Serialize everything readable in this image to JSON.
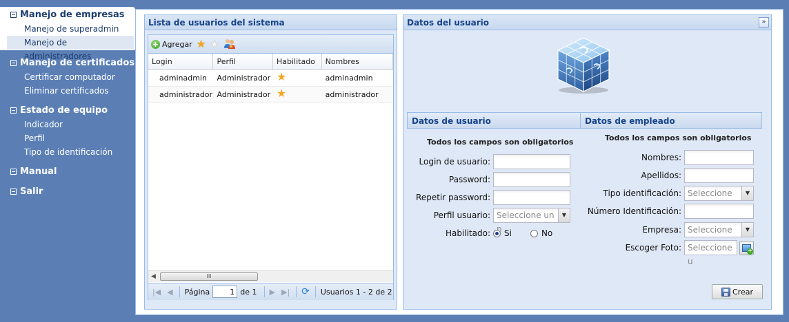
{
  "sidebar": {
    "groups": [
      {
        "label": "Manejo de empresas",
        "items": [
          "Manejo de superadmin",
          "Manejo de administradores"
        ]
      },
      {
        "label": "Manejo de certificados",
        "items": [
          "Certificar computador",
          "Eliminar certificados"
        ]
      },
      {
        "label": "Estado de equipo",
        "items": [
          "Indicador",
          "Perfil",
          "Tipo de identificación"
        ]
      },
      {
        "label": "Manual",
        "items": []
      },
      {
        "label": "Salir",
        "items": []
      }
    ],
    "active_group": "Manejo de empresas",
    "selected_item": "Manejo de administradores"
  },
  "users_panel": {
    "title": "Lista de usuarios del sistema",
    "toolbar": {
      "add_label": "Agregar"
    },
    "columns": [
      "Login",
      "Perfil",
      "Habilitado",
      "Nombres"
    ],
    "rows": [
      {
        "login": "adminadmin",
        "perfil": "Administrador",
        "nombres": "adminadmin"
      },
      {
        "login": "administrador",
        "perfil": "Administrador",
        "nombres": "administrador"
      }
    ],
    "pager": {
      "page_label": "Página",
      "page_value": "1",
      "of_label": "de 1",
      "summary": "Usuarios 1 - 2 de 2"
    },
    "scroll_grip": "III"
  },
  "user_panel": {
    "title": "Datos del usuario",
    "collapse_glyph": "»",
    "left_section": {
      "heading": "Datos de usuario",
      "note": "Todos los campos son obligatorios",
      "fields": {
        "login": "Login de usuario:",
        "password": "Password:",
        "repeat_password": "Repetir password:",
        "profile": "Perfil usuario:",
        "profile_placeholder": "Seleccione un p",
        "enabled": "Habilitado:",
        "yes": "Si",
        "no": "No"
      }
    },
    "right_section": {
      "heading": "Datos de empleado",
      "note": "Todos los campos son obligatorios",
      "fields": {
        "names": "Nombres:",
        "surnames": "Apellidos:",
        "id_type": "Tipo identificación:",
        "id_type_placeholder": "Seleccione un",
        "id_number": "Número Identificación:",
        "company": "Empresa:",
        "company_placeholder": "Seleccione un",
        "photo": "Escoger Foto:",
        "photo_placeholder": "Seleccione u"
      }
    },
    "create_label": "Crear"
  },
  "colors": {
    "background": "#5b7fb5",
    "panel_border": "#99bbe8",
    "title_text": "#15428b"
  }
}
